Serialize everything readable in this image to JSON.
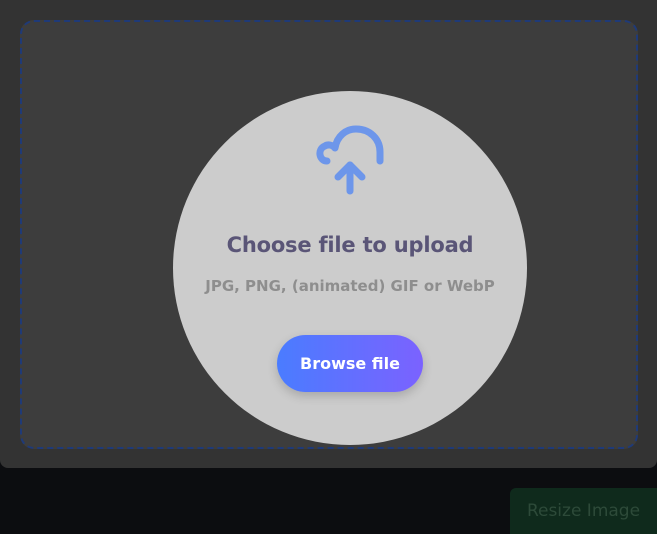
{
  "upload": {
    "title": "Choose file to upload",
    "formats": "JPG, PNG, (animated) GIF or WebP",
    "browse_label": "Browse file",
    "icon": "cloud-upload-icon"
  },
  "actions": {
    "resize_label": "Resize Image",
    "resize_state": "disabled"
  },
  "colors": {
    "panel_bg": "#333333",
    "dropzone_bg": "#3d3d3d",
    "dropzone_border": "#1f3a78",
    "circle_bg": "#cccccc",
    "icon": "#6d96ea",
    "title_text": "#5a5577",
    "formats_text": "#8e8e8e",
    "browse_gradient_start": "#4a7cff",
    "browse_gradient_end": "#7b62ff",
    "resize_bg": "#0f2a1c",
    "resize_text": "#2d4a39",
    "page_bg": "#0c0d10"
  }
}
